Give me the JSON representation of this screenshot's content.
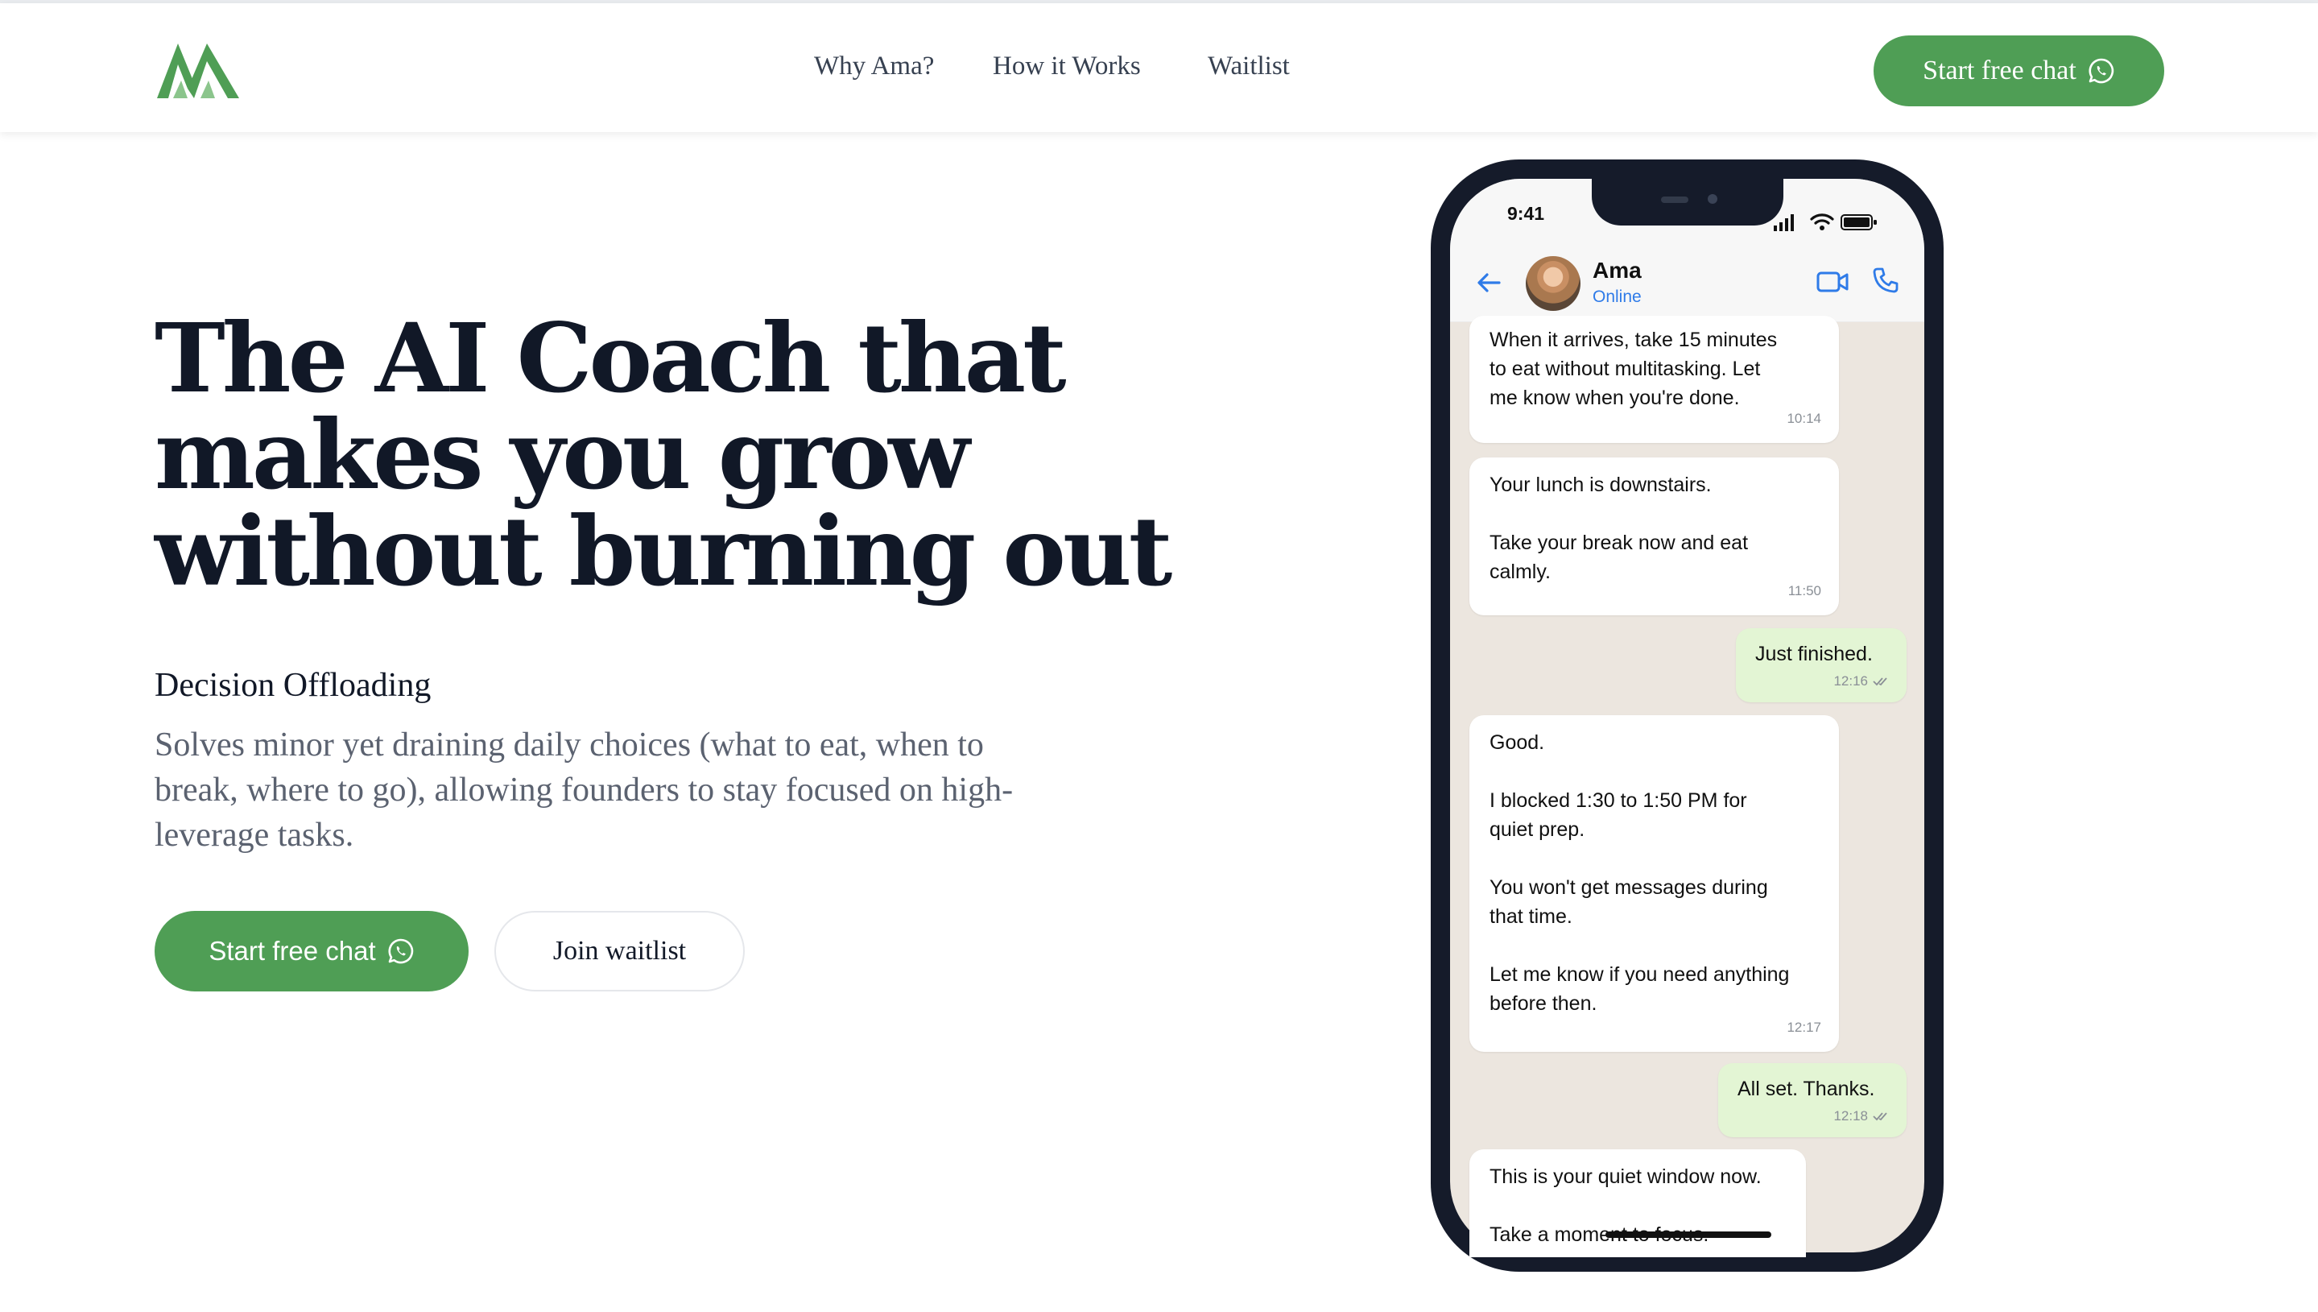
{
  "header": {
    "logo_icon": "ama-mountain-logo",
    "nav": [
      "Why Ama?",
      "How it Works",
      "Waitlist"
    ],
    "cta_label": "Start free chat",
    "cta_icon": "whatsapp-icon"
  },
  "hero": {
    "title_lines": [
      "The AI Coach that",
      "makes you grow",
      "without burning out"
    ],
    "feature_title": "Decision Offloading",
    "feature_desc_lines": [
      "Solves minor yet draining daily choices (what to eat, when to",
      "break, where to go), allowing founders to stay focused on high-",
      "leverage tasks."
    ],
    "primary_cta": "Start free chat",
    "secondary_cta": "Join waitlist"
  },
  "phone": {
    "status_time": "9:41",
    "contact_name": "Ama",
    "contact_status": "Online",
    "messages": [
      {
        "from": "ama",
        "lines": [
          "When it arrives, take 15 minutes",
          "to eat without multitasking. Let",
          "me know when you're done."
        ],
        "time": "10:14"
      },
      {
        "from": "ama",
        "lines": [
          "Your lunch is downstairs.",
          "",
          "Take your break now and eat",
          "calmly."
        ],
        "time": "11:50"
      },
      {
        "from": "user",
        "lines": [
          "Just finished."
        ],
        "time": "12:16"
      },
      {
        "from": "ama",
        "lines": [
          "Good.",
          "",
          "I blocked 1:30 to 1:50 PM for",
          "quiet prep.",
          "",
          "You won't get messages during",
          "that time.",
          "",
          "Let me know if you need anything",
          "before then."
        ],
        "time": "12:17"
      },
      {
        "from": "user",
        "lines": [
          "All set. Thanks."
        ],
        "time": "12:18"
      },
      {
        "from": "ama",
        "lines": [
          "This is your quiet window now.",
          "",
          "Take a moment to focus."
        ],
        "time": ""
      }
    ]
  },
  "colors": {
    "brand_green": "#4f9e55",
    "chat_bg": "#ece6df",
    "outgoing_bubble": "#e3f5d4",
    "phone_frame": "#151b2a",
    "link_blue": "#2f7be8"
  }
}
